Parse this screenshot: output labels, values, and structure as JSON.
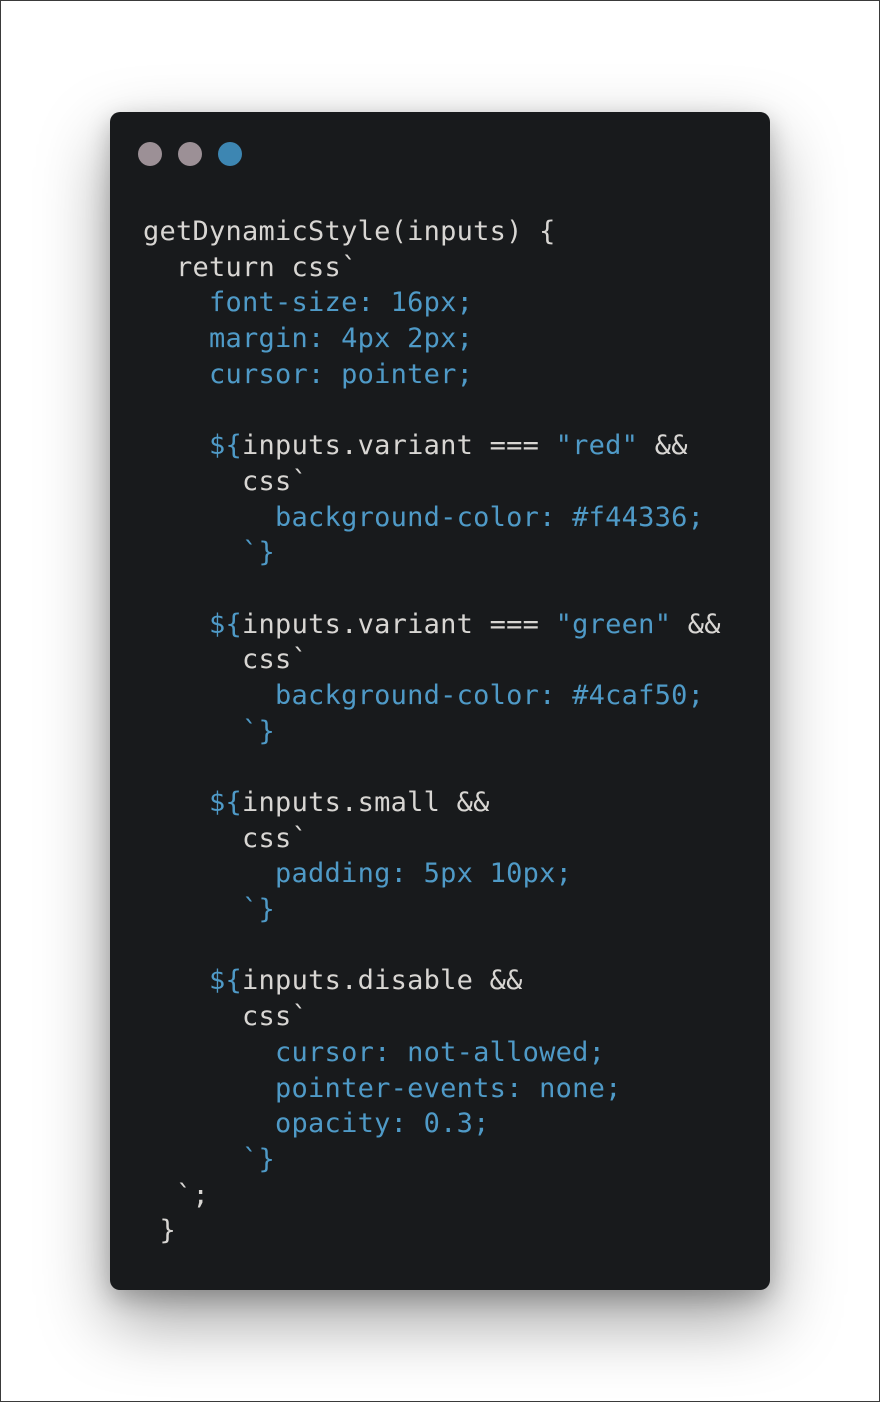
{
  "window": {
    "controls": [
      {
        "name": "close",
        "color": "#9c9096"
      },
      {
        "name": "minimize",
        "color": "#9c9096"
      },
      {
        "name": "maximize",
        "color": "#3d86b2"
      }
    ],
    "background": "#181a1c"
  },
  "colors": {
    "plain": "#d8d6d3",
    "property": "#4f9ac7"
  },
  "code": {
    "lines": [
      [
        {
          "t": "getDynamicStyle(inputs) {",
          "k": "plain"
        }
      ],
      [
        {
          "t": "  return css`",
          "k": "plain"
        }
      ],
      [
        {
          "t": "    font-size: 16px;",
          "k": "prop"
        }
      ],
      [
        {
          "t": "    margin: 4px 2px;",
          "k": "prop"
        }
      ],
      [
        {
          "t": "    cursor: pointer;",
          "k": "prop"
        }
      ],
      [],
      [
        {
          "t": "    ${",
          "k": "prop"
        },
        {
          "t": "inputs.variant === ",
          "k": "plain"
        },
        {
          "t": "\"red\"",
          "k": "prop"
        },
        {
          "t": " &&",
          "k": "plain"
        }
      ],
      [
        {
          "t": "      css`",
          "k": "plain"
        }
      ],
      [
        {
          "t": "        background-color: #f44336;",
          "k": "prop"
        }
      ],
      [
        {
          "t": "      `}",
          "k": "prop"
        }
      ],
      [],
      [
        {
          "t": "    ${",
          "k": "prop"
        },
        {
          "t": "inputs.variant === ",
          "k": "plain"
        },
        {
          "t": "\"green\"",
          "k": "prop"
        },
        {
          "t": " &&",
          "k": "plain"
        }
      ],
      [
        {
          "t": "      css`",
          "k": "plain"
        }
      ],
      [
        {
          "t": "        background-color: #4caf50;",
          "k": "prop"
        }
      ],
      [
        {
          "t": "      `}",
          "k": "prop"
        }
      ],
      [],
      [
        {
          "t": "    ${",
          "k": "prop"
        },
        {
          "t": "inputs.small &&",
          "k": "plain"
        }
      ],
      [
        {
          "t": "      css`",
          "k": "plain"
        }
      ],
      [
        {
          "t": "        padding: 5px 10px;",
          "k": "prop"
        }
      ],
      [
        {
          "t": "      `}",
          "k": "prop"
        }
      ],
      [],
      [
        {
          "t": "    ${",
          "k": "prop"
        },
        {
          "t": "inputs.disable &&",
          "k": "plain"
        }
      ],
      [
        {
          "t": "      css`",
          "k": "plain"
        }
      ],
      [
        {
          "t": "        cursor: not-allowed;",
          "k": "prop"
        }
      ],
      [
        {
          "t": "        pointer-events: none;",
          "k": "prop"
        }
      ],
      [
        {
          "t": "        opacity: 0.3;",
          "k": "prop"
        }
      ],
      [
        {
          "t": "      `}",
          "k": "prop"
        }
      ],
      [
        {
          "t": "  `;",
          "k": "plain"
        }
      ],
      [
        {
          "t": " }",
          "k": "plain"
        }
      ]
    ]
  }
}
